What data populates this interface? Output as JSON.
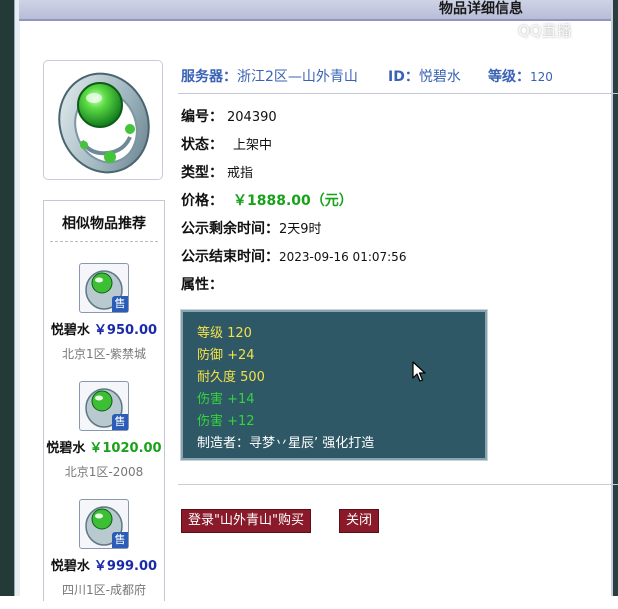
{
  "title": "物品详细信息",
  "watermark": "QQ直播",
  "header": {
    "server_label": "服务器：",
    "server_value": "浙江2区—山外青山",
    "id_label": "ID：",
    "id_value": "悦碧水",
    "level_label": "等级：",
    "level_value": "120"
  },
  "fields": {
    "number_label": "编号：",
    "number_value": "204390",
    "status_label": "状态：",
    "status_value": "上架中",
    "type_label": "类型：",
    "type_value": "戒指",
    "price_label": "价格：",
    "price_value": "￥1888.00（元）",
    "remaining_label": "公示剩余时间：",
    "remaining_value": "2天9时",
    "end_label": "公示结束时间：",
    "end_value": "2023-09-16 01:07:56",
    "attr_label": "属性："
  },
  "attributes": [
    {
      "text": "等级 120",
      "color": "#f4e04a"
    },
    {
      "text": "防御 +24",
      "color": "#f4e04a"
    },
    {
      "text": "耐久度 500",
      "color": "#f4e04a"
    },
    {
      "text": "伤害 +14",
      "color": "#34d43a"
    },
    {
      "text": "伤害 +12",
      "color": "#34d43a"
    },
    {
      "text": "制造者：寻梦丷星辰’ 强化打造",
      "color": "#ffffff"
    }
  ],
  "similar": {
    "title": "相似物品推荐",
    "badge": "售",
    "items": [
      {
        "name": "悦碧水",
        "price": "￥950.00",
        "price_color": "#1a2aa8",
        "server": "北京1区-紫禁城"
      },
      {
        "name": "悦碧水",
        "price": "￥1020.00",
        "price_color": "#18a21a",
        "server": "北京1区-2008"
      },
      {
        "name": "悦碧水",
        "price": "￥999.00",
        "price_color": "#1a2aa8",
        "server": "四川1区-成都府"
      }
    ]
  },
  "buttons": {
    "buy_label": "登录\"山外青山\"购买",
    "close_label": "关闭"
  }
}
